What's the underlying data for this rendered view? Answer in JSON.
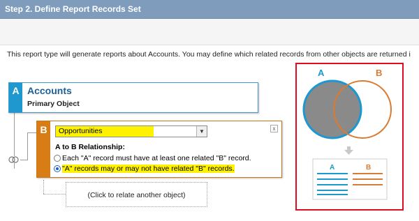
{
  "header": {
    "title": "Step 2. Define Report Records Set"
  },
  "intro_text": "This report type will generate reports about Accounts. You may define which related records from other objects are returned i",
  "object_a": {
    "letter": "A",
    "name": "Accounts",
    "subtitle": "Primary Object"
  },
  "object_b": {
    "letter": "B",
    "selected_object": "Opportunities",
    "close_label": "x",
    "relationship_label": "A to B Relationship:",
    "options": [
      {
        "text": "Each \"A\" record must have at least one related \"B\" record.",
        "selected": false
      },
      {
        "text": "\"A\" records may or may not have related \"B\" records.",
        "selected": true
      }
    ]
  },
  "add_object_text": "(Click to relate another object)",
  "venn": {
    "label_a": "A",
    "label_b": "B",
    "colors": {
      "a": "#1b98cf",
      "b": "#d87c35",
      "overlap_fill": "#8a8a8a",
      "frame": "#e00b20"
    }
  },
  "colors": {
    "header": "#7f9cbc",
    "accent_a": "#1f97cf",
    "accent_b": "#d87c15",
    "highlight": "#fff200"
  }
}
